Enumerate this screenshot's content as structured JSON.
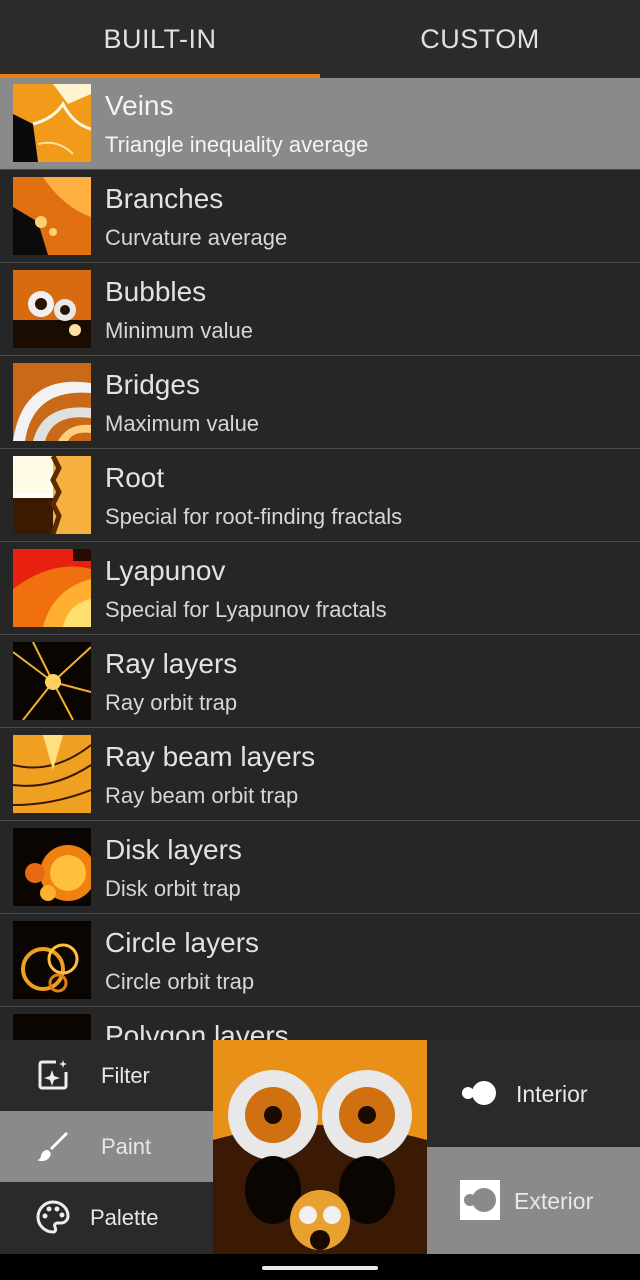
{
  "tabs": [
    {
      "label": "BUILT-IN",
      "active": true
    },
    {
      "label": "CUSTOM",
      "active": false
    }
  ],
  "accent_color": "#f07f12",
  "items": [
    {
      "title": "Veins",
      "subtitle": "Triangle inequality average",
      "selected": true
    },
    {
      "title": "Branches",
      "subtitle": "Curvature average"
    },
    {
      "title": "Bubbles",
      "subtitle": "Minimum value"
    },
    {
      "title": "Bridges",
      "subtitle": "Maximum value"
    },
    {
      "title": "Root",
      "subtitle": "Special for root-finding fractals"
    },
    {
      "title": "Lyapunov",
      "subtitle": "Special for Lyapunov fractals"
    },
    {
      "title": "Ray layers",
      "subtitle": "Ray orbit trap"
    },
    {
      "title": "Ray beam layers",
      "subtitle": "Ray beam orbit trap"
    },
    {
      "title": "Disk layers",
      "subtitle": "Disk orbit trap"
    },
    {
      "title": "Circle layers",
      "subtitle": "Circle orbit trap"
    },
    {
      "title": "Polygon layers",
      "subtitle": ""
    }
  ],
  "bottom_left": [
    {
      "label": "Filter",
      "icon": "filter-sparkle-icon"
    },
    {
      "label": "Paint",
      "icon": "brush-icon",
      "selected": true
    },
    {
      "label": "Palette",
      "icon": "palette-icon"
    }
  ],
  "bottom_right": [
    {
      "label": "Interior",
      "icon": "interior-toggle-icon"
    },
    {
      "label": "Exterior",
      "icon": "exterior-toggle-icon",
      "selected": true
    }
  ]
}
